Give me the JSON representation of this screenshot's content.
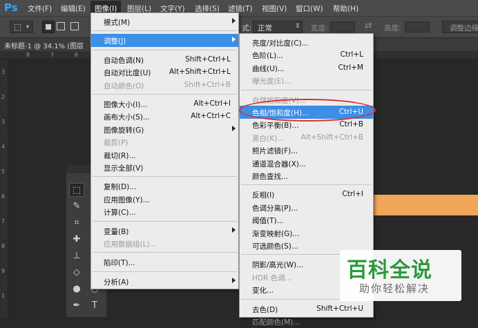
{
  "app": {
    "logo": "Ps"
  },
  "menubar": [
    {
      "label": "文件(F)",
      "active": false
    },
    {
      "label": "编辑(E)",
      "active": false
    },
    {
      "label": "图像(I)",
      "active": true
    },
    {
      "label": "图层(L)",
      "active": false
    },
    {
      "label": "文字(Y)",
      "active": false
    },
    {
      "label": "选择(S)",
      "active": false
    },
    {
      "label": "滤镜(T)",
      "active": false
    },
    {
      "label": "视图(V)",
      "active": false
    },
    {
      "label": "窗口(W)",
      "active": false
    },
    {
      "label": "帮助(H)",
      "active": false
    }
  ],
  "optionsbar": {
    "style_label": "式:",
    "style_value": "正常",
    "width_label": "宽度:",
    "height_label": "高度:",
    "refine_button": "调整边缘"
  },
  "document": {
    "tab_label": "未标题-1 @ 34.1% (图层",
    "ruler_top": [
      "8",
      "7",
      "6"
    ],
    "ruler_left": [
      "3",
      "2",
      "3",
      "4",
      "5",
      "6",
      "7",
      "8",
      "9",
      "1"
    ]
  },
  "image_menu": {
    "items": [
      {
        "label": "模式(M)",
        "shortcut": "",
        "disabled": false,
        "submenu": true,
        "highlight": false
      },
      {
        "sep": true
      },
      {
        "label": "调整(J)",
        "shortcut": "",
        "disabled": false,
        "submenu": true,
        "highlight": true
      },
      {
        "sep": true
      },
      {
        "label": "自动色调(N)",
        "shortcut": "Shift+Ctrl+L",
        "disabled": false
      },
      {
        "label": "自动对比度(U)",
        "shortcut": "Alt+Shift+Ctrl+L",
        "disabled": false
      },
      {
        "label": "自动颜色(O)",
        "shortcut": "Shift+Ctrl+B",
        "disabled": true
      },
      {
        "sep": true
      },
      {
        "label": "图像大小(I)...",
        "shortcut": "Alt+Ctrl+I",
        "disabled": false
      },
      {
        "label": "画布大小(S)...",
        "shortcut": "Alt+Ctrl+C",
        "disabled": false
      },
      {
        "label": "图像旋转(G)",
        "shortcut": "",
        "disabled": false,
        "submenu": true
      },
      {
        "label": "裁剪(P)",
        "shortcut": "",
        "disabled": true
      },
      {
        "label": "裁切(R)...",
        "shortcut": "",
        "disabled": false
      },
      {
        "label": "显示全部(V)",
        "shortcut": "",
        "disabled": false
      },
      {
        "sep": true
      },
      {
        "label": "复制(D)...",
        "shortcut": "",
        "disabled": false
      },
      {
        "label": "应用图像(Y)...",
        "shortcut": "",
        "disabled": false
      },
      {
        "label": "计算(C)...",
        "shortcut": "",
        "disabled": false
      },
      {
        "sep": true
      },
      {
        "label": "变量(B)",
        "shortcut": "",
        "disabled": false,
        "submenu": true
      },
      {
        "label": "应用数据组(L)...",
        "shortcut": "",
        "disabled": true
      },
      {
        "sep": true
      },
      {
        "label": "陷印(T)...",
        "shortcut": "",
        "disabled": false
      },
      {
        "sep": true
      },
      {
        "label": "分析(A)",
        "shortcut": "",
        "disabled": false,
        "submenu": true
      }
    ]
  },
  "adjust_menu": {
    "items": [
      {
        "label": "亮度/对比度(C)...",
        "shortcut": "",
        "disabled": false
      },
      {
        "label": "色阶(L)...",
        "shortcut": "Ctrl+L",
        "disabled": false
      },
      {
        "label": "曲线(U)...",
        "shortcut": "Ctrl+M",
        "disabled": false
      },
      {
        "label": "曝光度(E)...",
        "shortcut": "",
        "disabled": true
      },
      {
        "sep": true
      },
      {
        "label": "自然饱和度(V)...",
        "shortcut": "",
        "disabled": true
      },
      {
        "label": "色相/饱和度(H)...",
        "shortcut": "Ctrl+U",
        "disabled": false,
        "highlight": true
      },
      {
        "label": "色彩平衡(B)...",
        "shortcut": "Ctrl+B",
        "disabled": false
      },
      {
        "label": "黑白(K)...",
        "shortcut": "Alt+Shift+Ctrl+B",
        "disabled": true
      },
      {
        "label": "照片滤镜(F)...",
        "shortcut": "",
        "disabled": false
      },
      {
        "label": "通道混合器(X)...",
        "shortcut": "",
        "disabled": false
      },
      {
        "label": "颜色查找...",
        "shortcut": "",
        "disabled": false
      },
      {
        "sep": true
      },
      {
        "label": "反相(I)",
        "shortcut": "Ctrl+I",
        "disabled": false
      },
      {
        "label": "色调分离(P)...",
        "shortcut": "",
        "disabled": false
      },
      {
        "label": "阈值(T)...",
        "shortcut": "",
        "disabled": false
      },
      {
        "label": "渐变映射(G)...",
        "shortcut": "",
        "disabled": false
      },
      {
        "label": "可选颜色(S)...",
        "shortcut": "",
        "disabled": false
      },
      {
        "sep": true
      },
      {
        "label": "阴影/高光(W)...",
        "shortcut": "",
        "disabled": false
      },
      {
        "label": "HDR 色调...",
        "shortcut": "",
        "disabled": true
      },
      {
        "label": "变化...",
        "shortcut": "",
        "disabled": false
      },
      {
        "sep": true
      },
      {
        "label": "去色(D)",
        "shortcut": "Shift+Ctrl+U",
        "disabled": false
      },
      {
        "label": "匹配颜色(M)...",
        "shortcut": "",
        "disabled": true
      }
    ]
  },
  "watermark": {
    "title": "百科全说",
    "subtitle": "助你轻松解决"
  },
  "colors": {
    "highlight": "#3d8ee6",
    "brand_green": "#2b9a3b",
    "annotation_red": "#d9302c",
    "orange_bar": "#f2a65a"
  }
}
